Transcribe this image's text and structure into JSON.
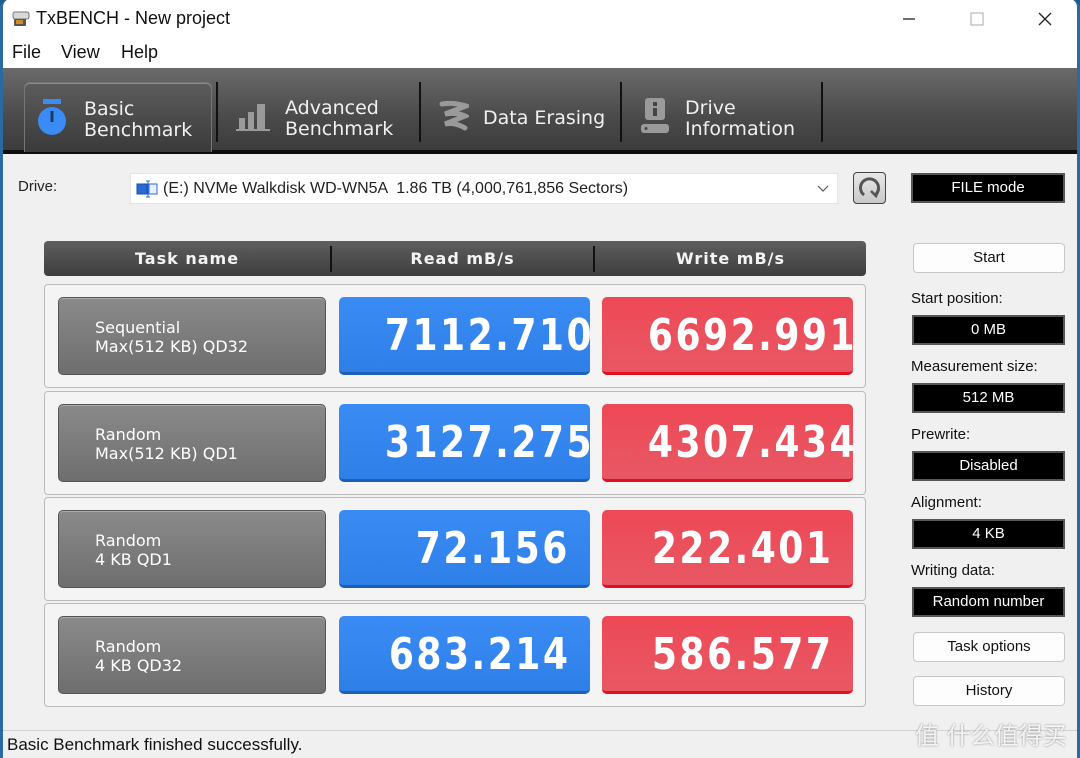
{
  "window": {
    "title": "TxBENCH - New project",
    "controls": {
      "minimize": "—",
      "maximize": "☐",
      "close": "✕"
    }
  },
  "menu": [
    "File",
    "View",
    "Help"
  ],
  "tabs": [
    {
      "label": "Basic\nBenchmark",
      "icon": "stopwatch-icon",
      "active": true
    },
    {
      "label": "Advanced\nBenchmark",
      "icon": "bar-chart-icon",
      "active": false
    },
    {
      "label": "Data Erasing",
      "icon": "eraser-icon",
      "active": false
    },
    {
      "label": "Drive\nInformation",
      "icon": "drive-info-icon",
      "active": false
    }
  ],
  "drive": {
    "label": "Drive:",
    "selected": "(E:) NVMe Walkdisk WD-WN5A  1.86 TB (4,000,761,856 Sectors)",
    "mode": "FILE mode"
  },
  "grid": {
    "headers": [
      "Task name",
      "Read mB/s",
      "Write mB/s"
    ],
    "rows": [
      {
        "task": "Sequential\nMax(512 KB) QD32",
        "read": "7112.710",
        "write": "6692.991"
      },
      {
        "task": "Random\nMax(512 KB) QD1",
        "read": "3127.275",
        "write": "4307.434"
      },
      {
        "task": "Random\n4 KB QD1",
        "read": "72.156",
        "write": "222.401"
      },
      {
        "task": "Random\n4 KB QD32",
        "read": "683.214",
        "write": "586.577"
      }
    ]
  },
  "side": {
    "start_label": "Start",
    "start_position_label": "Start position:",
    "start_position": "0 MB",
    "measurement_size_label": "Measurement size:",
    "measurement_size": "512 MB",
    "prewrite_label": "Prewrite:",
    "prewrite": "Disabled",
    "alignment_label": "Alignment:",
    "alignment": "4 KB",
    "writing_data_label": "Writing data:",
    "writing_data": "Random number",
    "task_options_label": "Task options",
    "history_label": "History"
  },
  "status": "Basic Benchmark finished successfully.",
  "watermark": "值 什么值得买",
  "colors": {
    "read": "#3a8bf4",
    "write": "#ee4856",
    "accent": "#3a8bf4"
  }
}
